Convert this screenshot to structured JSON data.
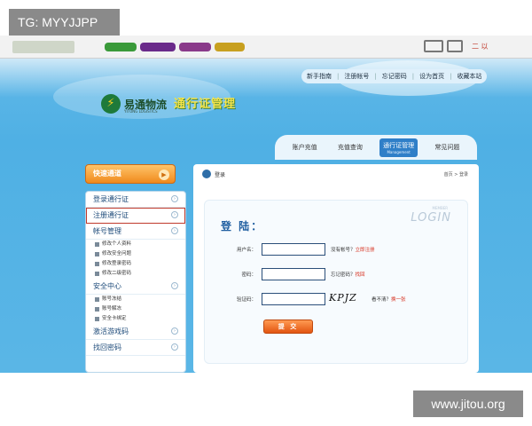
{
  "overlay": {
    "tg_label": "TG: MYYJJPP",
    "watermark": "www.jitou.org"
  },
  "browser": {
    "right_text": "二 以"
  },
  "site": {
    "brand_name": "易通物流",
    "brand_sub": "YITONG LOGISTICS",
    "slogan": "通行证管理",
    "top_links": [
      "新手指南",
      "注册帐号",
      "忘记密码",
      "设为首页",
      "收藏本站"
    ],
    "nav": [
      {
        "label": "账户充值",
        "sub": ""
      },
      {
        "label": "充值查询",
        "sub": ""
      },
      {
        "label": "通行证管理",
        "sub": "Management",
        "active": true
      },
      {
        "label": "常见问题",
        "sub": ""
      }
    ]
  },
  "sidebar": {
    "menu_button": "快速通道",
    "sections": [
      {
        "label": "登录通行证",
        "highlight": false,
        "items": []
      },
      {
        "label": "注册通行证",
        "highlight": true,
        "items": []
      },
      {
        "label": "帐号管理",
        "highlight": false,
        "items": [
          "修改个人资料",
          "修改安全问题",
          "修改登录密码",
          "修改二级密码"
        ]
      },
      {
        "label": "安全中心",
        "highlight": false,
        "items": [
          "账号冻结",
          "账号解冻",
          "安全卡绑定"
        ]
      },
      {
        "label": "激活游戏码",
        "highlight": false,
        "items": []
      },
      {
        "label": "找回密码",
        "highlight": false,
        "items": []
      }
    ]
  },
  "content": {
    "breadcrumb": "登录",
    "breadcrumb_right": "首页 > 登录",
    "login_watermark": "LOGIN",
    "login_watermark_sub": "MEMBER",
    "title": "登 陆：",
    "username_label": "用户名：",
    "username_hint": "没有帐号？",
    "username_hint_link": "立即注册",
    "password_label": "密码：",
    "password_hint": "忘记密码？",
    "password_hint_link": "找回",
    "captcha_label": "验证码：",
    "captcha_text": "KPJZ",
    "captcha_hint": "看不清？",
    "captcha_hint_link": "换一张",
    "submit_label": "提 交"
  },
  "colors": {
    "sky": "#4fb0e4",
    "nav_active": "#2f7fc8",
    "orange": "#f08a1c",
    "highlight_box": "#c0392b"
  }
}
